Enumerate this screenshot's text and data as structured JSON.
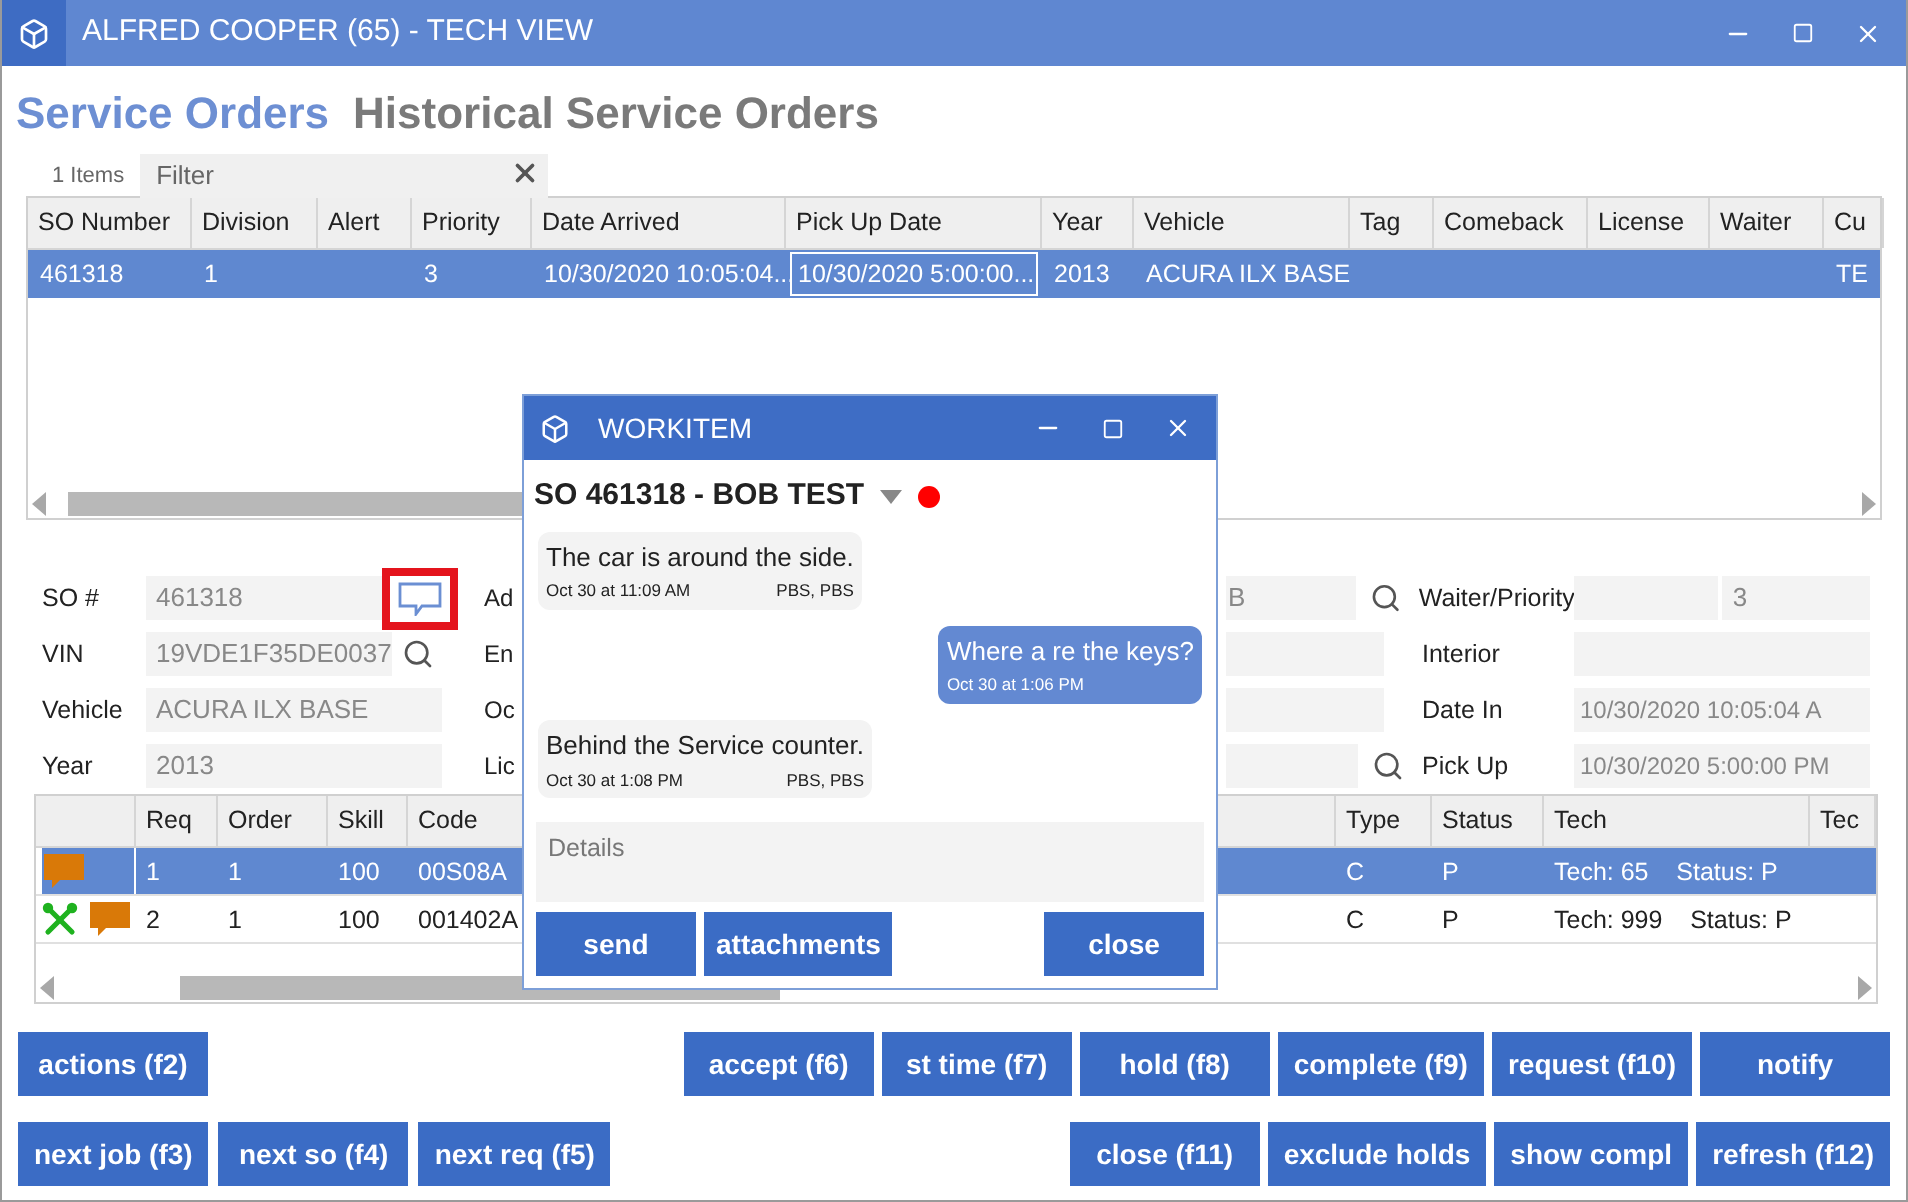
{
  "window": {
    "title": "ALFRED COOPER (65) - TECH VIEW"
  },
  "tabs": [
    {
      "label": "Service Orders",
      "selected": true
    },
    {
      "label": "Historical Service Orders",
      "selected": false
    }
  ],
  "item_count": "1 Items",
  "filter": {
    "placeholder": "Filter"
  },
  "orders_table": {
    "columns": [
      "SO Number",
      "Division",
      "Alert",
      "Priority",
      "Date Arrived",
      "Pick Up Date",
      "Year",
      "Vehicle",
      "Tag",
      "Comeback",
      "License",
      "Waiter",
      "Cu"
    ],
    "rows": [
      {
        "selected": true,
        "cells": [
          {
            "text": "461318",
            "focused": false
          },
          {
            "text": "1",
            "focused": false
          },
          null,
          {
            "text": "3",
            "focused": false
          },
          {
            "text": "10/30/2020 10:05:04...",
            "focused": false
          },
          {
            "text": "10/30/2020 5:00:00...",
            "focused": true
          },
          {
            "text": "2013",
            "focused": false
          },
          {
            "text": "ACURA ILX BASE",
            "focused": false
          },
          null,
          null,
          null,
          null,
          {
            "text": "TE",
            "focused": false
          }
        ]
      }
    ]
  },
  "form": {
    "left": [
      {
        "label": "SO #",
        "value": "461318",
        "kind": "chat",
        "highlighted": true
      },
      {
        "label": "VIN",
        "value": "19VDE1F35DE0037",
        "kind": "search"
      },
      {
        "label": "Vehicle",
        "value": "ACURA ILX BASE",
        "kind": "plain"
      },
      {
        "label": "Year",
        "value": "2013",
        "kind": "plain"
      }
    ],
    "middle_labels": [
      "Ad",
      "En",
      "Oc",
      "Lic"
    ],
    "right": [
      {
        "value": "B",
        "search": true,
        "label": "Waiter/Priority",
        "kind": "split",
        "second_value": "3"
      },
      {
        "search": false,
        "label": "Interior",
        "kind": "plain"
      },
      {
        "search": false,
        "label": "Date In",
        "kind": "plain",
        "second_value": "10/30/2020 10:05:04 A"
      },
      {
        "search": true,
        "label": "Pick Up",
        "kind": "plain",
        "second_value": "10/30/2020 5:00:00 PM"
      }
    ]
  },
  "lines_table": {
    "columns": [
      "Req",
      "Order",
      "Skill",
      "Code",
      "Type",
      "Status",
      "Tech",
      "Tec"
    ],
    "rows": [
      {
        "selected": true,
        "icons": [
          {
            "kind": "note"
          }
        ],
        "cells": [
          "1",
          "1",
          "100",
          "00S08A",
          "C",
          "P",
          "Tech: 65    Status: P"
        ]
      },
      {
        "selected": false,
        "icons": [
          {
            "kind": "tools"
          },
          {
            "kind": "note"
          }
        ],
        "cells": [
          "2",
          "1",
          "100",
          "001402A",
          "C",
          "P",
          "Tech: 999    Status: P"
        ]
      }
    ]
  },
  "toolbar": [
    {
      "left": [
        "actions (f2)"
      ],
      "right": [
        "accept (f6)",
        "st time (f7)",
        "hold (f8)",
        "complete (f9)",
        "request (f10)",
        "notify"
      ]
    },
    {
      "left": [
        "next job (f3)",
        "next so (f4)",
        "next req (f5)"
      ],
      "right": [
        "close (f11)",
        "exclude holds",
        "show compl",
        "refresh (f12)"
      ]
    }
  ],
  "dialog": {
    "title": "WORKITEM",
    "heading": "SO 461318 - BOB TEST",
    "color": "#ff0000",
    "messages": [
      {
        "kind": "incoming",
        "text": "The car is around the side.",
        "time": "Oct 30 at 11:09 AM",
        "author": "PBS, PBS"
      },
      {
        "kind": "outgoing",
        "text": "Where a re the keys?",
        "time": "Oct 30 at 1:06 PM"
      },
      {
        "kind": "incoming",
        "text": "Behind the Service counter.",
        "time": "Oct 30 at 1:08 PM",
        "author": "PBS, PBS"
      }
    ],
    "details": {
      "placeholder": "Details"
    },
    "buttons": [
      "send",
      "attachments"
    ],
    "end_buttons": [
      "close"
    ]
  }
}
